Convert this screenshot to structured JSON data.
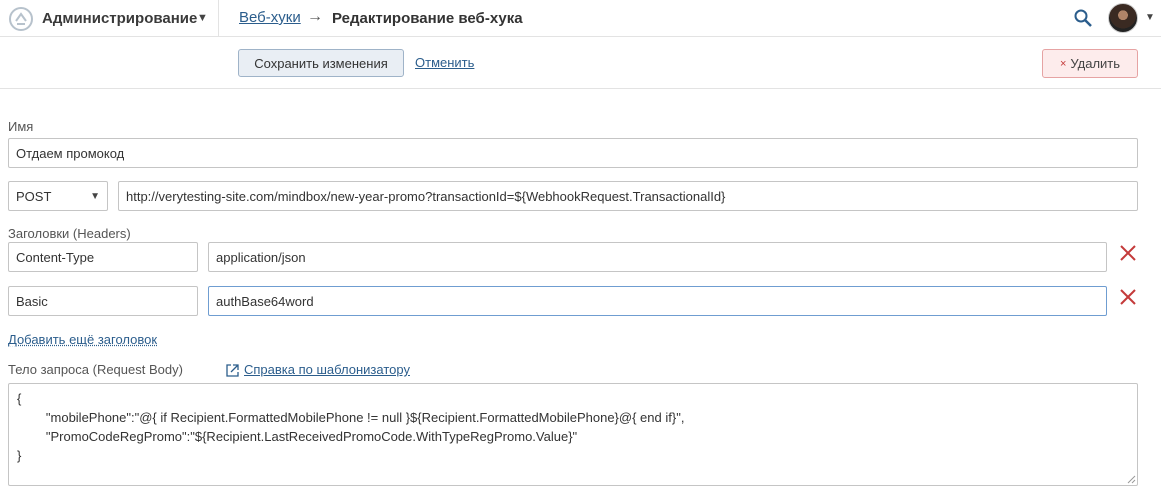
{
  "header": {
    "app_title": "Администрирование",
    "breadcrumb_parent": "Веб-хуки",
    "breadcrumb_arrow": "→",
    "breadcrumb_current": "Редактирование веб-хука"
  },
  "actions": {
    "save_label": "Сохранить изменения",
    "cancel_label": "Отменить",
    "delete_icon": "×",
    "delete_label": "Удалить"
  },
  "form": {
    "name_label": "Имя",
    "name_value": "Отдаем промокод",
    "method_value": "POST",
    "url_value": "http://verytesting-site.com/mindbox/new-year-promo?transactionId=${WebhookRequest.TransactionalId}",
    "headers_label": "Заголовки (Headers)",
    "headers": [
      {
        "name": "Content-Type",
        "value": "application/json"
      },
      {
        "name": "Basic",
        "value": "authBase64word"
      }
    ],
    "add_header_label": "Добавить ещё заголовок",
    "body_label": "Тело запроса (Request Body)",
    "help_link_label": "Справка по шаблонизатору",
    "body_lines": [
      "{",
      "        \"mobilePhone\":\"@{ if Recipient.FormattedMobilePhone != null }${Recipient.FormattedMobilePhone}@{ end if}\",",
      "        \"PromoCodeRegPromo\":\"${Recipient.LastReceivedPromoCode.WithTypeRegPromo.Value}\"",
      "}"
    ]
  },
  "colors": {
    "link": "#2b5d8c",
    "delete_red": "#c43a3a",
    "focus_border": "#6f9dd1"
  },
  "icons": [
    "app-logo-icon",
    "search-icon",
    "close-icon",
    "external-link-icon",
    "chevron-down-icon"
  ]
}
